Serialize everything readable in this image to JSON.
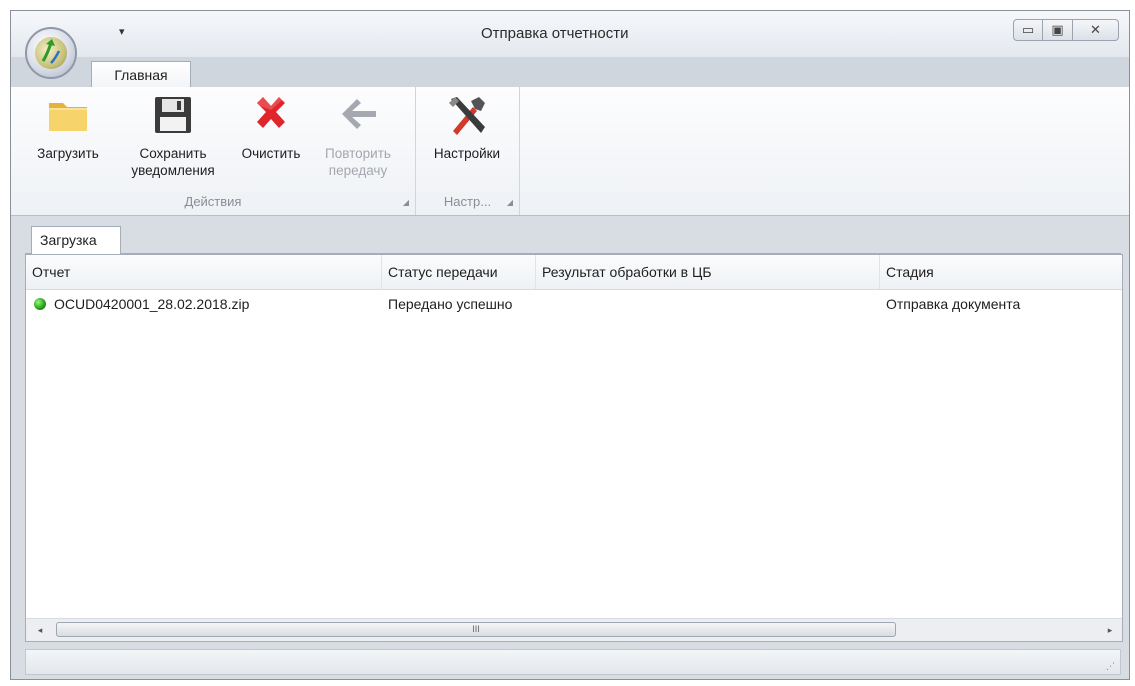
{
  "window": {
    "title": "Отправка отчетности",
    "qat_dropdown": "▾",
    "controls": {
      "minimize": "▭",
      "restore": "▣",
      "close": "✕"
    }
  },
  "ribbon": {
    "tabs": [
      {
        "label": "Главная",
        "active": true
      }
    ],
    "groups": [
      {
        "label": "Действия",
        "buttons": [
          {
            "label_line1": "Загрузить",
            "label_line2": "",
            "icon": "folder-icon",
            "enabled": true
          },
          {
            "label_line1": "Сохранить",
            "label_line2": "уведомления",
            "icon": "floppy-disk-icon",
            "enabled": true
          },
          {
            "label_line1": "Очистить",
            "label_line2": "",
            "icon": "red-x-icon",
            "enabled": true
          },
          {
            "label_line1": "Повторить",
            "label_line2": "передачу",
            "icon": "back-arrow-icon",
            "enabled": false
          }
        ]
      },
      {
        "label": "Настр...",
        "buttons": [
          {
            "label_line1": "Настройки",
            "label_line2": "",
            "icon": "tools-icon",
            "enabled": true
          }
        ]
      }
    ]
  },
  "document_tabs": [
    {
      "label": "Загрузка",
      "active": true
    }
  ],
  "grid": {
    "columns": [
      "Отчет",
      "Статус передачи",
      "Результат обработки в ЦБ",
      "Стадия"
    ],
    "rows": [
      {
        "status_icon": "green-dot-icon",
        "report": "OCUD0420001_28.02.2018.zip",
        "transfer_status": "Передано успешно",
        "cb_result": "",
        "stage": "Отправка документа"
      }
    ],
    "scrollbar": {
      "left_arrow": "◂",
      "right_arrow": "▸",
      "thumb_grip": "III"
    }
  },
  "statusbar": {
    "grip": "⋰"
  },
  "colors": {
    "accent_red": "#e0262a",
    "status_green": "#2fae1f",
    "folder_yellow": "#f2c84b"
  }
}
